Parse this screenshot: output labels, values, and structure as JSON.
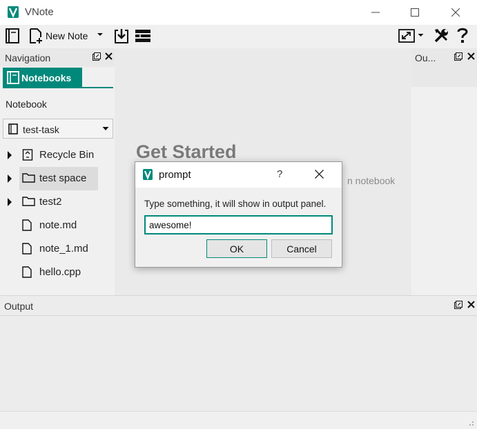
{
  "window": {
    "title": "VNote"
  },
  "toolbar": {
    "new_note_label": "New Note"
  },
  "navigation": {
    "title": "Navigation",
    "tab_label": "Notebooks",
    "notebook_label": "Notebook",
    "selected_notebook": "test-task",
    "items": [
      {
        "label": "Recycle Bin",
        "icon": "recycle-bin-icon",
        "expandable": true
      },
      {
        "label": "test space",
        "icon": "folder-icon",
        "expandable": true,
        "selected": true
      },
      {
        "label": "test2",
        "icon": "folder-icon",
        "expandable": true
      },
      {
        "label": "note.md",
        "icon": "file-icon",
        "expandable": false
      },
      {
        "label": "note_1.md",
        "icon": "file-icon",
        "expandable": false
      },
      {
        "label": "hello.cpp",
        "icon": "file-icon",
        "expandable": false
      }
    ]
  },
  "main": {
    "heading": "Get Started",
    "hint_fragment": "n notebook"
  },
  "outline": {
    "title": "Ou..."
  },
  "output": {
    "title": "Output"
  },
  "dialog": {
    "title": "prompt",
    "help_glyph": "?",
    "message": "Type something, it will show in output panel.",
    "input_value": "awesome!",
    "ok_label": "OK",
    "cancel_label": "Cancel"
  },
  "colors": {
    "accent": "#00897b",
    "selected_row": "#dcdcdc"
  }
}
